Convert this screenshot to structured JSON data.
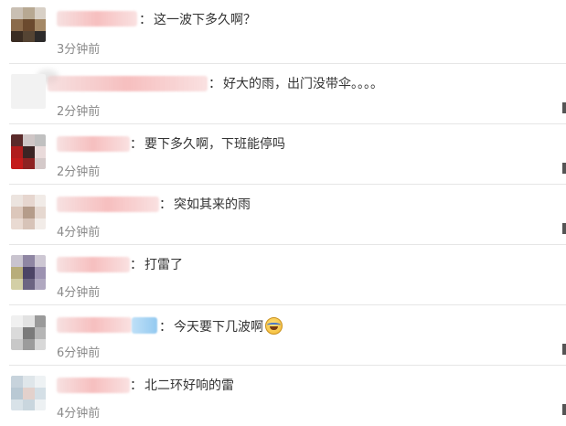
{
  "comments": [
    {
      "text": "这一波下多久啊？",
      "time": "3分钟前"
    },
    {
      "text": "好大的雨，出门没带伞。。。。",
      "time": "2分钟前"
    },
    {
      "text": "要下多久啊，下班能停吗",
      "time": "2分钟前"
    },
    {
      "text": "突如其来的雨",
      "time": "4分钟前"
    },
    {
      "text": "打雷了",
      "time": "4分钟前"
    },
    {
      "text": "今天要下几波啊",
      "time": "6分钟前"
    },
    {
      "text": "北二环好响的雷",
      "time": "4分钟前"
    }
  ],
  "colon": "：",
  "colors": {
    "divider": "#e6e6e6",
    "time": "#8a8a8a",
    "text": "#333333"
  },
  "icons": {
    "emoji": "laugh-cry-icon"
  }
}
